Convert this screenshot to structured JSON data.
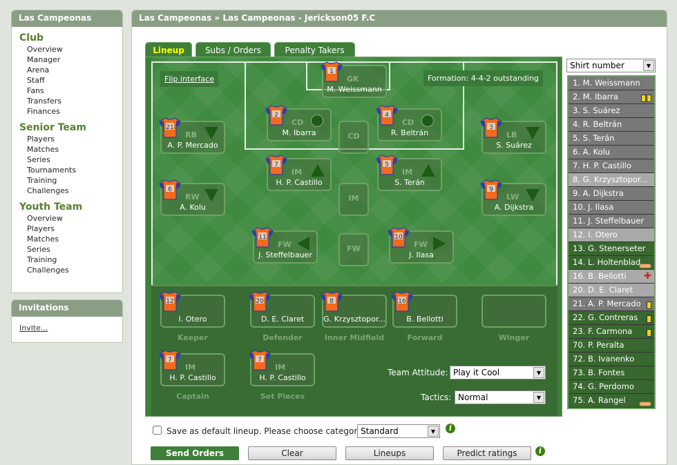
{
  "sidebar": {
    "title": "Las Campeonas",
    "sections": [
      {
        "heading": "Club",
        "items": [
          "Overview",
          "Manager",
          "Arena",
          "Staff",
          "Fans",
          "Transfers",
          "Finances"
        ]
      },
      {
        "heading": "Senior Team",
        "items": [
          "Players",
          "Matches",
          "Series",
          "Tournaments",
          "Training",
          "Challenges"
        ]
      },
      {
        "heading": "Youth Team",
        "items": [
          "Overview",
          "Players",
          "Matches",
          "Series",
          "Training",
          "Challenges"
        ]
      }
    ]
  },
  "invitations": {
    "title": "Invitations",
    "link": "Invite..."
  },
  "breadcrumb": "Las Campeonas »  Las Campeonas - Jerickson05 F.C",
  "tabs": [
    "Lineup",
    "Subs / Orders",
    "Penalty Takers"
  ],
  "flip_label": "Flip interface",
  "formation": "Formation: 4-4-2 outstanding",
  "lineup": [
    {
      "num": "1",
      "pos": "GK",
      "name": "M. Weissmann",
      "ind": ""
    },
    {
      "num": "2",
      "pos": "CD",
      "name": "M. Ibarra",
      "ind": "circle"
    },
    {
      "num": "4",
      "pos": "CD",
      "name": "R. Beltrán",
      "ind": "circle"
    },
    {
      "num": "21",
      "pos": "RB",
      "name": "A. P. Mercado",
      "ind": "down"
    },
    {
      "num": "3",
      "pos": "LB",
      "name": "S. Suárez",
      "ind": "down"
    },
    {
      "num": "7",
      "pos": "IM",
      "name": "H. P. Castillo",
      "ind": "up"
    },
    {
      "num": "5",
      "pos": "IM",
      "name": "S. Terán",
      "ind": "up"
    },
    {
      "num": "6",
      "pos": "RW",
      "name": "A. Kolu",
      "ind": "down"
    },
    {
      "num": "9",
      "pos": "LW",
      "name": "A. Dijkstra",
      "ind": "down"
    },
    {
      "num": "11",
      "pos": "FW",
      "name": "J. Steffelbauer",
      "ind": "left"
    },
    {
      "num": "10",
      "pos": "FW",
      "name": "J. Ilasa",
      "ind": "right"
    }
  ],
  "empty_slots": [
    "CD",
    "IM",
    "FW"
  ],
  "substitutes": [
    {
      "num": "12",
      "name": "I. Otero",
      "role": "Keeper"
    },
    {
      "num": "20",
      "name": "D. E. Claret",
      "role": "Defender"
    },
    {
      "num": "8",
      "name": "G. Krzysztopor...",
      "role": "Inner Midfield"
    },
    {
      "num": "16",
      "name": "B. Bellotti",
      "role": "Forward"
    },
    {
      "num": "",
      "name": "",
      "role": "Winger"
    }
  ],
  "specials": [
    {
      "num": "7",
      "pos": "IM",
      "name": "H. P. Castillo",
      "role": "Captain"
    },
    {
      "num": "7",
      "pos": "IM",
      "name": "H. P. Castillo",
      "role": "Set Pieces"
    }
  ],
  "team_attitude": {
    "label": "Team Attitude:",
    "value": "Play it Cool"
  },
  "tactics": {
    "label": "Tactics:",
    "value": "Normal"
  },
  "sort_select": "Shirt number",
  "players": [
    {
      "label": "1. M. Weissmann",
      "state": "start",
      "badge": ""
    },
    {
      "label": "2. M. Ibarra",
      "state": "start",
      "badge": "two-yellow-cards"
    },
    {
      "label": "3. S. Suárez",
      "state": "start",
      "badge": ""
    },
    {
      "label": "4. R. Beltrán",
      "state": "start",
      "badge": ""
    },
    {
      "label": "5. S. Terán",
      "state": "start",
      "badge": ""
    },
    {
      "label": "6. A. Kolu",
      "state": "start",
      "badge": ""
    },
    {
      "label": "7. H. P. Castillo",
      "state": "start",
      "badge": ""
    },
    {
      "label": "8. G. Krzysztopor...",
      "state": "sub",
      "badge": ""
    },
    {
      "label": "9. A. Dijkstra",
      "state": "start",
      "badge": ""
    },
    {
      "label": "10. J. Ilasa",
      "state": "start",
      "badge": ""
    },
    {
      "label": "11. J. Steffelbauer",
      "state": "start",
      "badge": ""
    },
    {
      "label": "12. I. Otero",
      "state": "sub",
      "badge": ""
    },
    {
      "label": "13. G. Stenerseter",
      "state": "out",
      "badge": ""
    },
    {
      "label": "14. L. Holtenblad",
      "state": "out",
      "badge": "bandage"
    },
    {
      "label": "16. B. Bellotti",
      "state": "sub",
      "badge": "injury-cross"
    },
    {
      "label": "20. D. E. Claret",
      "state": "sub",
      "badge": ""
    },
    {
      "label": "21. A. P. Mercado",
      "state": "start",
      "badge": "yellow-card"
    },
    {
      "label": "22. G. Contreras",
      "state": "out",
      "badge": "yellow-card"
    },
    {
      "label": "23. F. Carmona",
      "state": "out",
      "badge": "yellow-card"
    },
    {
      "label": "70. P. Peralta",
      "state": "out",
      "badge": ""
    },
    {
      "label": "72. B. Ivanenko",
      "state": "out",
      "badge": ""
    },
    {
      "label": "73. B. Fontes",
      "state": "out",
      "badge": ""
    },
    {
      "label": "74. G. Perdomo",
      "state": "out",
      "badge": ""
    },
    {
      "label": "75. A. Rangel",
      "state": "out",
      "badge": "bandage"
    }
  ],
  "save_default": {
    "label": "Save as default lineup. Please choose category",
    "category": "Standard",
    "checked": false
  },
  "buttons": {
    "send": "Send Orders",
    "clear": "Clear",
    "lineups": "Lineups",
    "predict": "Predict ratings"
  },
  "info_icon": "i",
  "colors": {
    "accent": "#5a7f2e",
    "pitch": "#3f8a3f",
    "shirt_orange": "#f26a1b",
    "shirt_blue": "#2b3fa8",
    "active_tab": "#ffff00"
  }
}
